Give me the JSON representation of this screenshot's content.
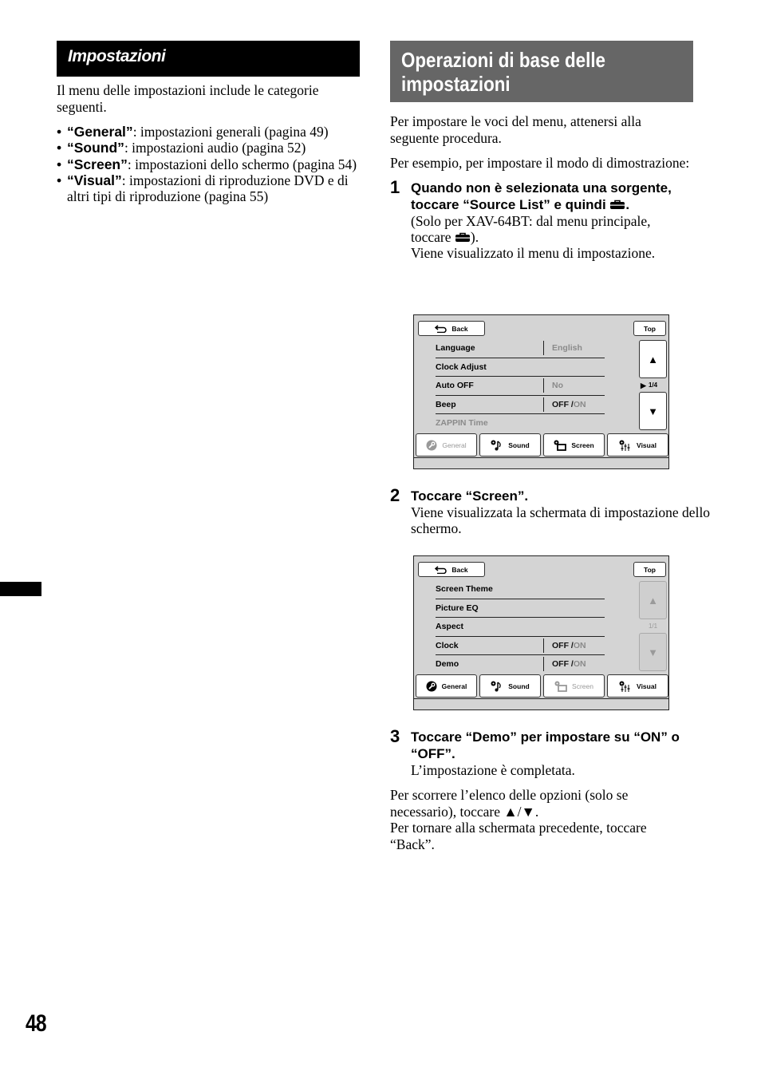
{
  "left": {
    "section_title": "Impostazioni",
    "intro": "Il menu delle impostazioni include le categorie seguenti.",
    "bullets": [
      {
        "term": "“General”",
        "desc": ": impostazioni generali (pagina 49)"
      },
      {
        "term": "“Sound”",
        "desc": ": impostazioni audio (pagina 52)"
      },
      {
        "term": "“Screen”",
        "desc": ": impostazioni dello schermo (pagina 54)"
      },
      {
        "term": "“Visual”",
        "desc": ": impostazioni di riproduzione DVD e di altri tipi di riproduzione (pagina 55)"
      }
    ],
    "bullet_glyph": "•"
  },
  "right": {
    "section_title_line1": "Operazioni di base delle",
    "section_title_line2": "impostazioni",
    "intro1": "Per impostare le voci del menu, attenersi alla seguente procedura.",
    "intro2": "Per esempio, per impostare il modo di dimostrazione:",
    "steps": [
      {
        "num": "1",
        "title_a": "Quando non è selezionata una sorgente, toccare “Source List” e quindi ",
        "title_b": ".",
        "body_a": "(Solo per XAV-64BT: dal menu principale, toccare ",
        "body_b": ").",
        "body_c": "Viene visualizzato il menu di impostazione."
      },
      {
        "num": "2",
        "title": "Toccare “Screen”.",
        "body": "Viene visualizzata la schermata di impostazione dello schermo."
      },
      {
        "num": "3",
        "title": "Toccare “Demo” per impostare su “ON” o “OFF”.",
        "body": "L’impostazione è completata."
      }
    ],
    "note1": "Per scorrere l’elenco delle opzioni (solo se necessario), toccare ▲/▼.",
    "note2": "Per tornare alla schermata precedente, toccare “Back”."
  },
  "screen1": {
    "back": "Back",
    "top": "Top",
    "up_arrow": "▲",
    "down_arrow": "▼",
    "page": "1/4",
    "rows": [
      {
        "label": "Language",
        "value": "English"
      },
      {
        "label": "Clock Adjust"
      },
      {
        "label": "Auto OFF",
        "value": "No"
      },
      {
        "label": "Beep",
        "value_off": "OFF /",
        "value_on": " ON"
      },
      {
        "label": "ZAPPIN Time"
      }
    ],
    "row_arrow": "▶",
    "tabs": [
      "General",
      "Sound",
      "Screen",
      "Visual"
    ]
  },
  "screen2": {
    "back": "Back",
    "top": "Top",
    "up_arrow": "▲",
    "down_arrow": "▼",
    "page": "1/1",
    "rows": [
      {
        "label": "Screen Theme"
      },
      {
        "label": "Picture EQ"
      },
      {
        "label": "Aspect"
      },
      {
        "label": "Clock",
        "value_off": "OFF /",
        "value_on": " ON"
      },
      {
        "label": "Demo",
        "value_off": "OFF /",
        "value_on": " ON"
      }
    ],
    "row_arrow": "▶",
    "tabs": [
      "General",
      "Sound",
      "Screen",
      "Visual"
    ]
  },
  "page_number": "48"
}
